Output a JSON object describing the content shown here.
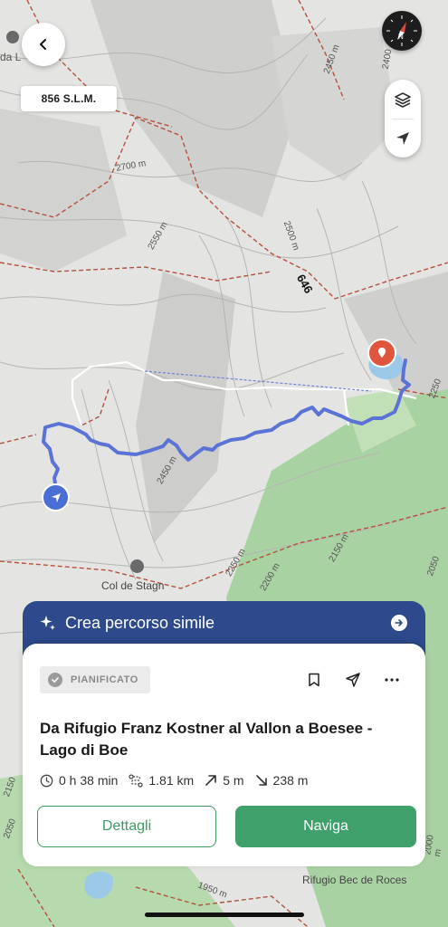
{
  "map": {
    "elevation_badge": "856 S.L.M.",
    "labels": {
      "top_left": "da L",
      "col_de_stagn": "Col de Stagn",
      "rifugio_bec": "Rifugio Bec de Roces",
      "trail_number": "646",
      "c2700": "2700 m",
      "c2550": "2550 m",
      "c2500": "2500 m",
      "c2450a": "2450 m",
      "c2450b": "2450 m",
      "c2400": "2400",
      "c2250": "2250 m",
      "c2200": "2200 m",
      "c2150": "2150 m",
      "c2150b": "2150",
      "c2050": "2050",
      "c2050b": "2050",
      "c2000": "2000 m",
      "c1950": "1950 m",
      "c2250b": "2250",
      "c2250c": "2250"
    },
    "route_color": "#5c73d6",
    "start_color": "#4a6fd4",
    "end_color": "#e0553d"
  },
  "banner": {
    "label": "Crea percorso simile",
    "color": "#2e4a8c"
  },
  "card": {
    "status": "PIANIFICATO",
    "title": "Da Rifugio Franz Kostner al Vallon a Boesee - Lago di Boe",
    "stats": {
      "duration": "0 h 38 min",
      "distance": "1.81 km",
      "ascent": "5 m",
      "descent": "238 m"
    },
    "details_label": "Dettagli",
    "navigate_label": "Naviga",
    "accent": "#3fa06b"
  }
}
